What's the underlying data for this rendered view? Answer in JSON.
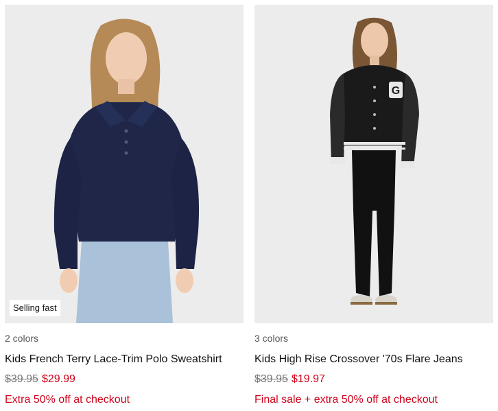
{
  "products": [
    {
      "badge": "Selling fast",
      "colors": "2 colors",
      "title": "Kids French Terry Lace-Trim Polo Sweatshirt",
      "price_original": "$39.95",
      "price_sale": "$29.99",
      "promo": "Extra 50% off at checkout"
    },
    {
      "colors": "3 colors",
      "title": "Kids High Rise Crossover '70s Flare Jeans",
      "price_original": "$39.95",
      "price_sale": "$19.97",
      "promo": "Final sale + extra 50% off at checkout"
    }
  ],
  "theme": {
    "sale_color": "#d0021b",
    "muted_color": "#767676",
    "photo_bg": "#ececec"
  }
}
